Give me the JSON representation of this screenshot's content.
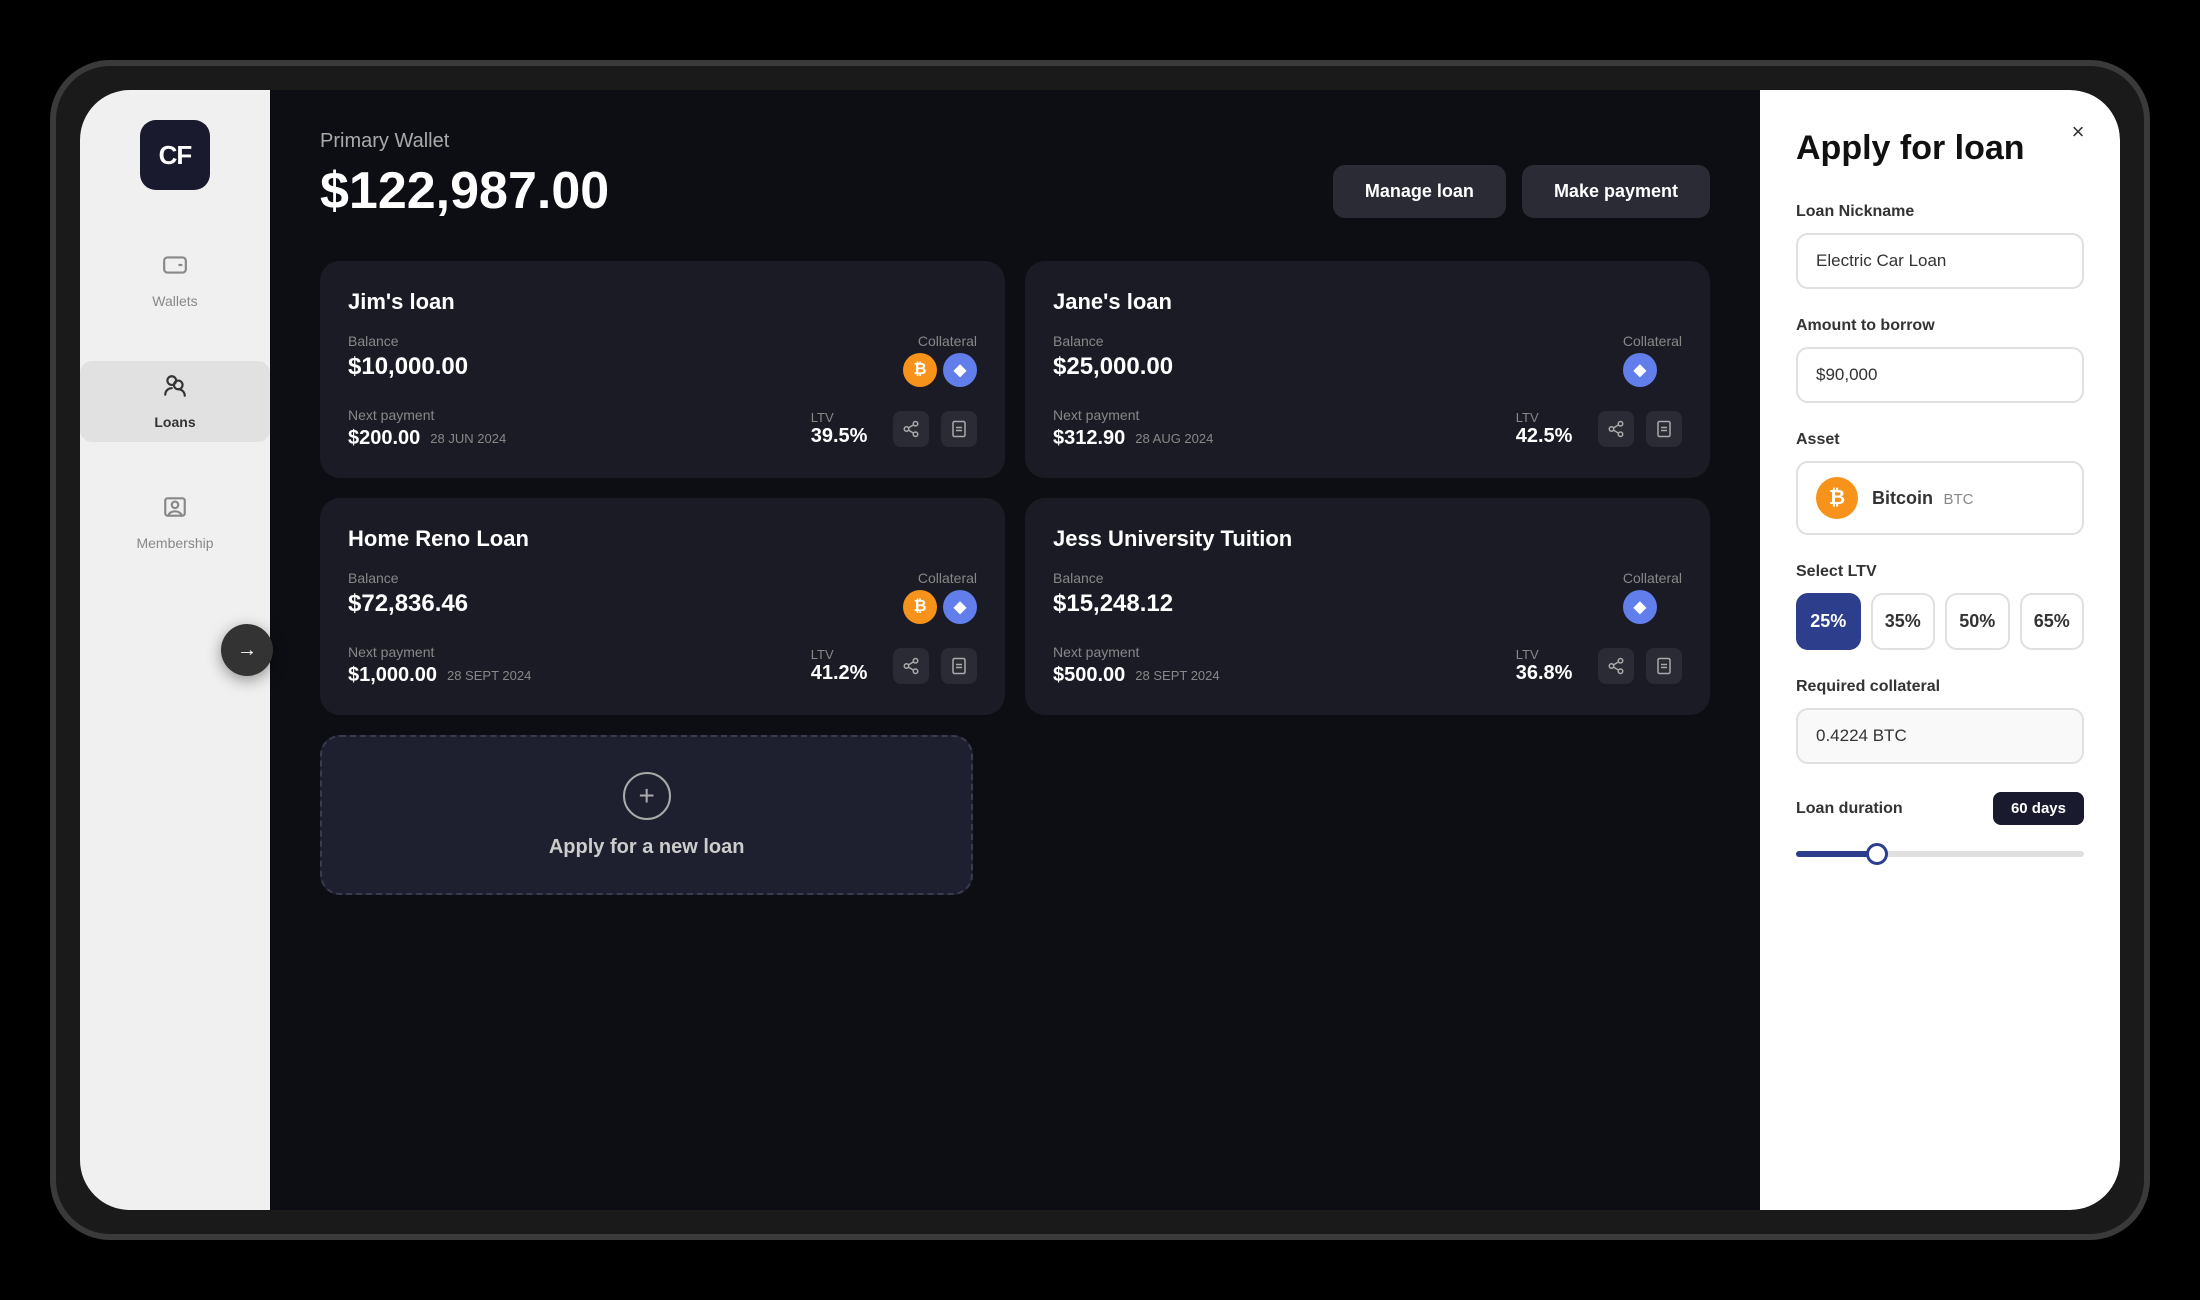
{
  "app": {
    "logo": "CF"
  },
  "sidebar": {
    "items": [
      {
        "id": "wallets",
        "label": "Wallets",
        "icon": "🗂",
        "active": false
      },
      {
        "id": "loans",
        "label": "Loans",
        "icon": "👥",
        "active": true
      },
      {
        "id": "membership",
        "label": "Membership",
        "icon": "👤",
        "active": false
      }
    ]
  },
  "wallet": {
    "label": "Primary Wallet",
    "balance": "$122,987.00",
    "actions": {
      "manage": "Manage loan",
      "payment": "Make payment"
    }
  },
  "loans": [
    {
      "id": "jims-loan",
      "title": "Jim's loan",
      "balance_label": "Balance",
      "balance": "$10,000.00",
      "collateral_label": "Collateral",
      "collateral_icons": [
        "btc",
        "eth"
      ],
      "next_payment_label": "Next payment",
      "next_payment_value": "$200.00",
      "next_payment_date": "28 JUN 2024",
      "ltv_label": "LTV",
      "ltv_value": "39.5%",
      "ltv_status": "green"
    },
    {
      "id": "janes-loan",
      "title": "Jane's loan",
      "balance_label": "Balance",
      "balance": "$25,000.00",
      "collateral_label": "Collateral",
      "collateral_icons": [
        "eth"
      ],
      "next_payment_label": "Next payment",
      "next_payment_value": "$312.90",
      "next_payment_date": "28 AUG 2024",
      "ltv_label": "LTV",
      "ltv_value": "42.5%",
      "ltv_status": "green"
    },
    {
      "id": "home-reno-loan",
      "title": "Home Reno Loan",
      "balance_label": "Balance",
      "balance": "$72,836.46",
      "collateral_label": "Collateral",
      "collateral_icons": [
        "btc",
        "eth"
      ],
      "next_payment_label": "Next payment",
      "next_payment_value": "$1,000.00",
      "next_payment_date": "28 SEPT 2024",
      "ltv_label": "LTV",
      "ltv_value": "41.2%",
      "ltv_status": "green"
    },
    {
      "id": "jess-university",
      "title": "Jess University Tuition",
      "balance_label": "Balance",
      "balance": "$15,248.12",
      "collateral_label": "Collateral",
      "collateral_icons": [
        "eth"
      ],
      "next_payment_label": "Next payment",
      "next_payment_value": "$500.00",
      "next_payment_date": "28 SEPT 2024",
      "ltv_label": "LTV",
      "ltv_value": "36.8%",
      "ltv_status": "orange"
    }
  ],
  "new_loan_card": {
    "label": "Apply for a new loan"
  },
  "apply_panel": {
    "title": "Apply for loan",
    "close_label": "×",
    "loan_nickname_label": "Loan Nickname",
    "loan_nickname_value": "Electric Car Loan",
    "amount_label": "Amount to borrow",
    "amount_value": "$90,000",
    "asset_label": "Asset",
    "asset_name": "Bitcoin",
    "asset_symbol": "BTC",
    "select_ltv_label": "Select LTV",
    "ltv_options": [
      "25%",
      "35%",
      "50%",
      "65%"
    ],
    "ltv_selected": 0,
    "required_collateral_label": "Required collateral",
    "required_collateral_value": "0.4224 BTC",
    "loan_duration_label": "Loan duration",
    "loan_duration_value": "60 days",
    "slider_percent": 30
  }
}
